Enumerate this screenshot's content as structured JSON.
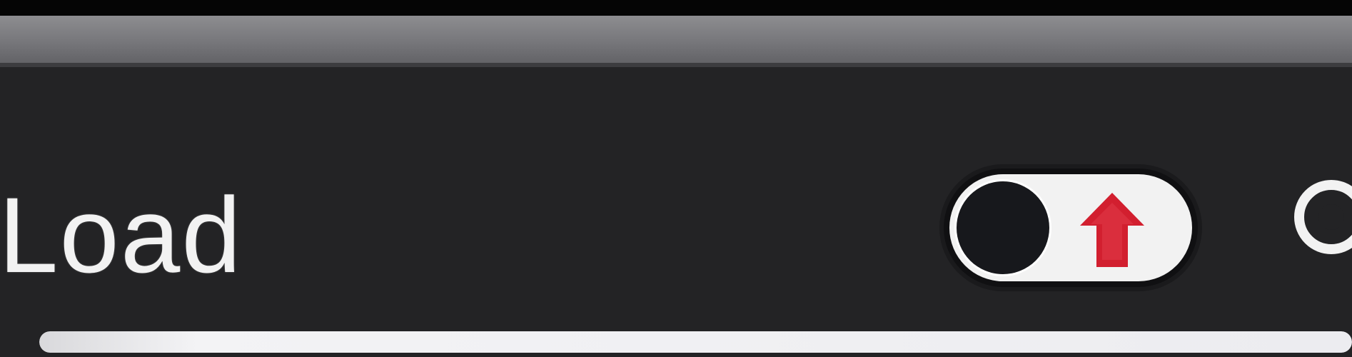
{
  "title": "Load",
  "toggle": {
    "state": "off",
    "icon": "up-arrow-icon",
    "accent": "#d21f2f"
  },
  "progress": {
    "value": 1
  },
  "colors": {
    "background": "#242426",
    "top_bar": "#7f7f83",
    "foreground": "#f2f2f2"
  }
}
